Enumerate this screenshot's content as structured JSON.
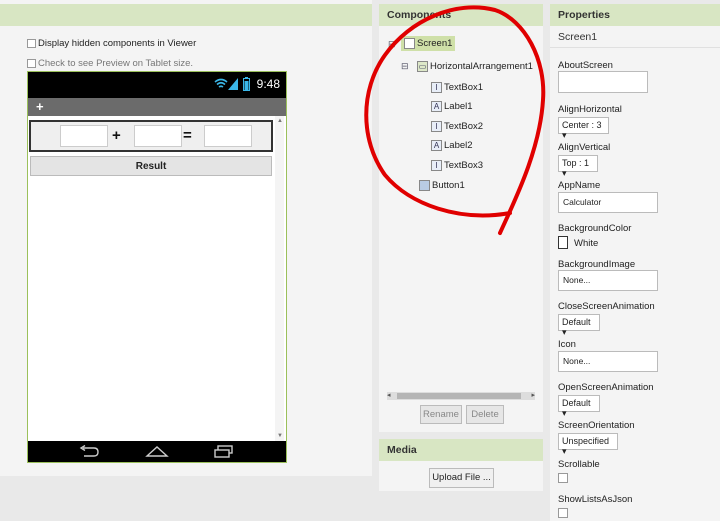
{
  "viewer": {
    "display_hidden_label": "Display hidden components in Viewer",
    "tablet_preview_label": "Check to see Preview on Tablet size.",
    "clock": "9:48",
    "title_symbol": "+",
    "plus_label": "+",
    "equals_label": "=",
    "result_label": "Result"
  },
  "components": {
    "title": "Components",
    "tree": {
      "screen": "Screen1",
      "harr": "HorizontalArrangement1",
      "textbox1": "TextBox1",
      "label1": "Label1",
      "textbox2": "TextBox2",
      "label2": "Label2",
      "textbox3": "TextBox3",
      "button1": "Button1"
    },
    "rename_label": "Rename",
    "delete_label": "Delete"
  },
  "media": {
    "title": "Media",
    "upload_label": "Upload File ..."
  },
  "properties": {
    "title": "Properties",
    "component": "Screen1",
    "about_label": "AboutScreen",
    "align_h_label": "AlignHorizontal",
    "align_h_value": "Center : 3 ▾",
    "align_v_label": "AlignVertical",
    "align_v_value": "Top : 1 ▾",
    "appname_label": "AppName",
    "appname_value": "Calculator",
    "bgcolor_label": "BackgroundColor",
    "bgcolor_value": "White",
    "bgimage_label": "BackgroundImage",
    "bgimage_value": "None...",
    "close_anim_label": "CloseScreenAnimation",
    "close_anim_value": "Default ▾",
    "icon_label": "Icon",
    "icon_value": "None...",
    "open_anim_label": "OpenScreenAnimation",
    "open_anim_value": "Default ▾",
    "orientation_label": "ScreenOrientation",
    "orientation_value": "Unspecified ▾",
    "scrollable_label": "Scrollable",
    "showlists_label": "ShowListsAsJson"
  },
  "colors": {
    "panel_header": "#d8e6c3",
    "selection": "#cfe0a8",
    "annotation": "#e00000"
  }
}
